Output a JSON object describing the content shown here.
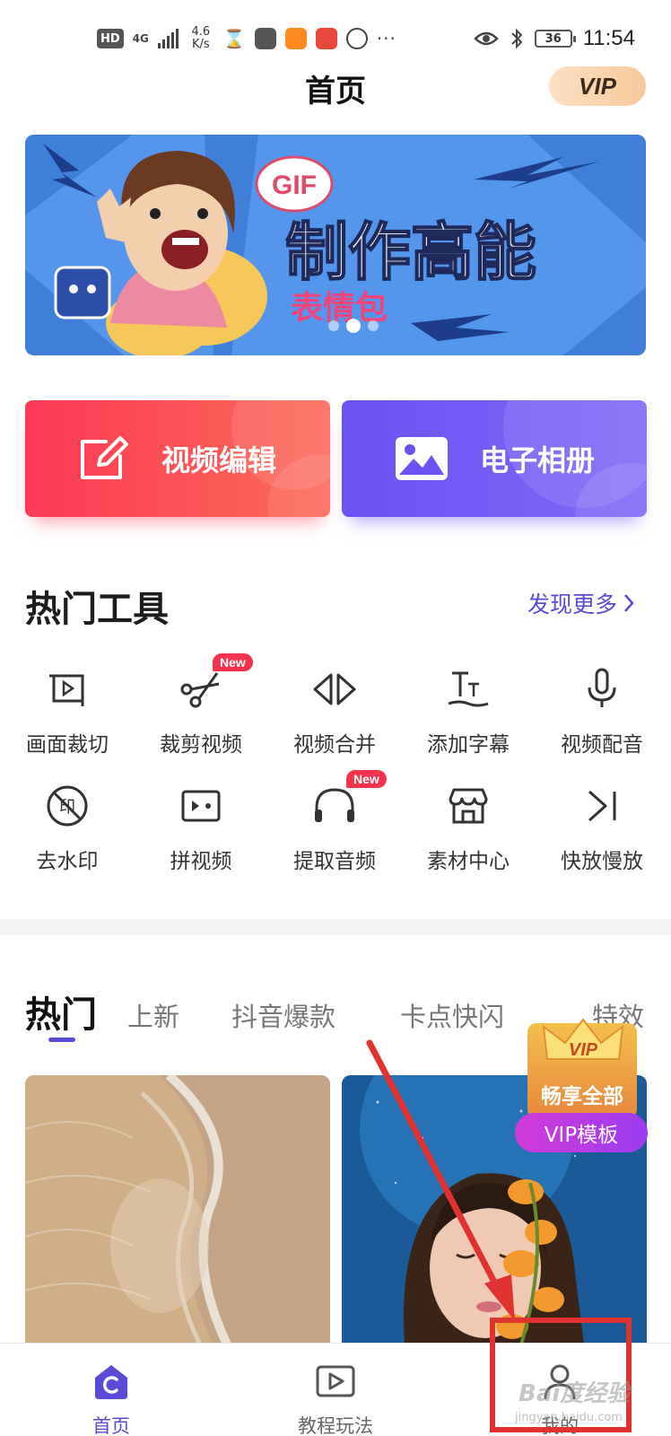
{
  "status_bar": {
    "hd": "HD",
    "network": "4G",
    "speed_value": "4.6",
    "speed_unit": "K/s",
    "battery": "36",
    "time": "11:54"
  },
  "header": {
    "title": "首页",
    "vip_label": "VIP"
  },
  "banner": {
    "gif_tag": "GIF",
    "headline": "制作高能",
    "subline": "表情包"
  },
  "features": {
    "video_edit": "视频编辑",
    "album": "电子相册"
  },
  "hot_tools": {
    "title": "热门工具",
    "more_label": "发现更多",
    "new_badge": "New",
    "items": [
      {
        "label": "画面裁切",
        "icon": "crop-icon"
      },
      {
        "label": "裁剪视频",
        "icon": "scissors-icon",
        "new": true
      },
      {
        "label": "视频合并",
        "icon": "merge-icon"
      },
      {
        "label": "添加字幕",
        "icon": "subtitle-icon"
      },
      {
        "label": "视频配音",
        "icon": "microphone-icon"
      },
      {
        "label": "去水印",
        "icon": "watermark-remove-icon"
      },
      {
        "label": "拼视频",
        "icon": "collage-icon"
      },
      {
        "label": "提取音频",
        "icon": "headphones-icon",
        "new": true
      },
      {
        "label": "素材中心",
        "icon": "store-icon"
      },
      {
        "label": "快放慢放",
        "icon": "speed-icon"
      }
    ]
  },
  "tabs": [
    "热门",
    "上新",
    "抖音爆款",
    "卡点快闪",
    "特效"
  ],
  "vip_promo": {
    "badge": "VIP",
    "line1": "畅享全部",
    "line2": "VIP模板"
  },
  "bottom_nav": [
    {
      "label": "首页",
      "icon": "home-icon",
      "active": true
    },
    {
      "label": "教程玩法",
      "icon": "tutorial-play-icon",
      "active": false
    },
    {
      "label": "我的",
      "icon": "profile-icon",
      "active": false
    }
  ],
  "watermark": {
    "text": "Bai度经验",
    "sub": "jingyan.baidu.com"
  },
  "colors": {
    "accent": "#5a4bd6",
    "edit_button": "#fb3a56",
    "album_button": "#6a52f4",
    "new_badge": "#f5334f",
    "annotation": "#e0322f"
  }
}
